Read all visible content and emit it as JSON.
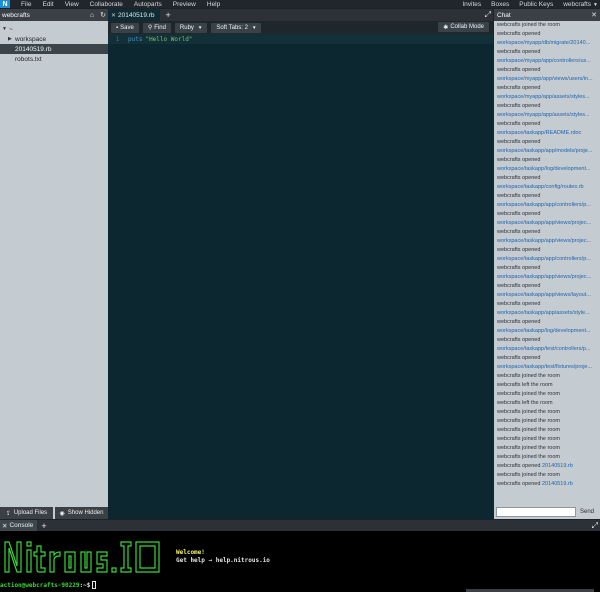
{
  "menubar": {
    "logo": "N",
    "items": [
      "File",
      "Edit",
      "View",
      "Collaborate",
      "Autoparts",
      "Preview",
      "Help"
    ],
    "right_items": [
      "Invites",
      "Boxes",
      "Public Keys",
      "webcrafts"
    ]
  },
  "left_panel": {
    "title": "webcrafts",
    "root_label": "~",
    "tree": [
      {
        "label": "workspace",
        "type": "folder"
      },
      {
        "label": "20140519.rb",
        "type": "file",
        "selected": true
      },
      {
        "label": "robots.txt",
        "type": "file"
      }
    ],
    "upload_label": "Upload Files",
    "show_hidden_label": "Show Hidden"
  },
  "editor": {
    "tab_label": "20140519.rb",
    "toolbar": {
      "save_label": "Save",
      "find_label": "Find",
      "language_label": "Ruby",
      "soft_tabs_label": "Soft Tabs: 2",
      "collab_label": "Collab Mode"
    },
    "lines": [
      {
        "number": "1",
        "keyword": "puts",
        "string": "\"Hello World\""
      }
    ]
  },
  "chat": {
    "title": "Chat",
    "send_label": "Send",
    "messages": [
      {
        "text": "webcrafts joined the room",
        "link": ""
      },
      {
        "text": "webcrafts opened",
        "link": ""
      },
      {
        "text": "",
        "link": "workspace/myapp/db/migrate/20140..."
      },
      {
        "text": "webcrafts opened",
        "link": ""
      },
      {
        "text": "",
        "link": "workspace/myapp/app/controllers/us..."
      },
      {
        "text": "webcrafts opened",
        "link": ""
      },
      {
        "text": "",
        "link": "workspace/myapp/app/views/users/in..."
      },
      {
        "text": "webcrafts opened",
        "link": ""
      },
      {
        "text": "",
        "link": "workspace/myapp/app/assets/styles..."
      },
      {
        "text": "webcrafts opened",
        "link": ""
      },
      {
        "text": "",
        "link": "workspace/myapp/app/assets/styles..."
      },
      {
        "text": "webcrafts opened",
        "link": ""
      },
      {
        "text": "",
        "link": "workspace/taskapp/README.rdoc"
      },
      {
        "text": "webcrafts opened",
        "link": ""
      },
      {
        "text": "",
        "link": "workspace/taskapp/app/models/proje..."
      },
      {
        "text": "webcrafts opened",
        "link": ""
      },
      {
        "text": "",
        "link": "workspace/taskapp/log/development..."
      },
      {
        "text": "webcrafts opened",
        "link": ""
      },
      {
        "text": "",
        "link": "workspace/taskapp/config/routes.rb"
      },
      {
        "text": "webcrafts opened",
        "link": ""
      },
      {
        "text": "",
        "link": "workspace/taskapp/app/controllers/p..."
      },
      {
        "text": "webcrafts opened",
        "link": ""
      },
      {
        "text": "",
        "link": "workspace/taskapp/app/views/projec..."
      },
      {
        "text": "webcrafts opened",
        "link": ""
      },
      {
        "text": "",
        "link": "workspace/taskapp/app/views/projec..."
      },
      {
        "text": "webcrafts opened",
        "link": ""
      },
      {
        "text": "",
        "link": "workspace/taskapp/app/controllers/p..."
      },
      {
        "text": "webcrafts opened",
        "link": ""
      },
      {
        "text": "",
        "link": "workspace/taskapp/app/views/projec..."
      },
      {
        "text": "webcrafts opened",
        "link": ""
      },
      {
        "text": "",
        "link": "workspace/taskapp/app/views/layout..."
      },
      {
        "text": "webcrafts opened",
        "link": ""
      },
      {
        "text": "",
        "link": "workspace/taskapp/app/assets/style..."
      },
      {
        "text": "webcrafts opened",
        "link": ""
      },
      {
        "text": "",
        "link": "workspace/taskapp/log/development..."
      },
      {
        "text": "webcrafts opened",
        "link": ""
      },
      {
        "text": "",
        "link": "workspace/taskapp/test/controllers/p..."
      },
      {
        "text": "webcrafts opened",
        "link": ""
      },
      {
        "text": "",
        "link": "workspace/taskapp/test/fixtures/proje..."
      },
      {
        "text": "webcrafts joined the room",
        "link": ""
      },
      {
        "text": "webcrafts left the room",
        "link": ""
      },
      {
        "text": "webcrafts joined the room",
        "link": ""
      },
      {
        "text": "webcrafts left the room",
        "link": ""
      },
      {
        "text": "webcrafts joined the room",
        "link": ""
      },
      {
        "text": "webcrafts joined the room",
        "link": ""
      },
      {
        "text": "webcrafts joined the room",
        "link": ""
      },
      {
        "text": "webcrafts joined the room",
        "link": ""
      },
      {
        "text": "webcrafts joined the room",
        "link": ""
      },
      {
        "text": "webcrafts joined the room",
        "link": ""
      },
      {
        "text": "webcrafts opened ",
        "link": "20140519.rb"
      },
      {
        "text": "webcrafts joined the room",
        "link": ""
      },
      {
        "text": "webcrafts opened ",
        "link": "20140519.rb"
      }
    ]
  },
  "console": {
    "tab_label": "Console",
    "ascii_banner": "Nitrous.IO",
    "welcome": "Welcome!",
    "help": "Get help → help.nitrous.io",
    "prompt_user": "action@webcrafts-90229",
    "prompt_path": ":~$"
  },
  "colors": {
    "accent": "#1b8fd2",
    "editor_bg": "#0c272f",
    "panel_bg": "#c5ccd1",
    "terminal_green": "#39d639",
    "terminal_yellow": "#f4f46a",
    "link": "#1f62ad"
  }
}
